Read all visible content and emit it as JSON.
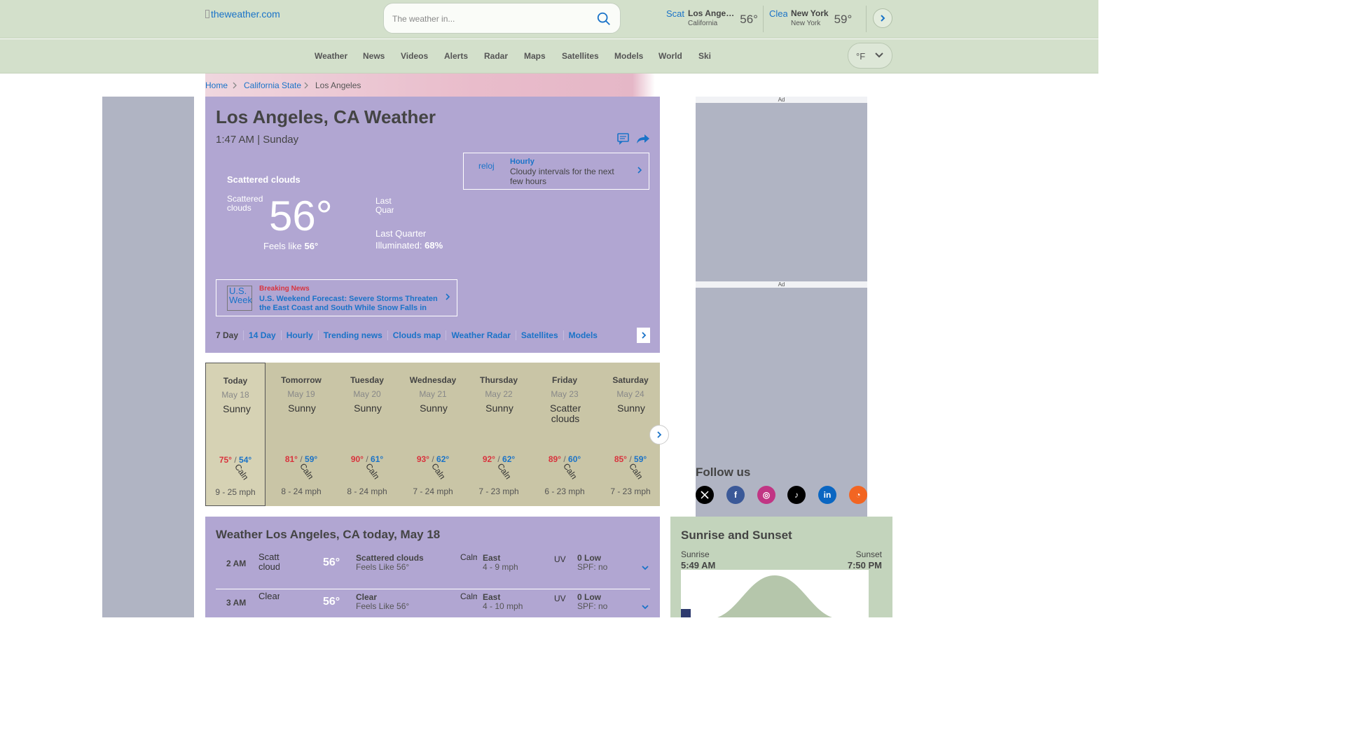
{
  "header": {
    "logo_alt": "theweather.com",
    "search_placeholder": "The weather in...",
    "locations": [
      {
        "icon_alt": "Scat",
        "name": "Los Ange…",
        "state": "California",
        "temp": "56°"
      },
      {
        "icon_alt": "Clea",
        "name": "New York",
        "state": "New York",
        "temp": "59°"
      }
    ]
  },
  "nav": {
    "items": [
      "Weather",
      "News",
      "Videos",
      "Alerts",
      "Radar",
      "Maps",
      "Satellites",
      "Models",
      "World",
      "Ski"
    ],
    "unit": "°F"
  },
  "breadcrumb": [
    "Home",
    "California State",
    "Los Angeles"
  ],
  "current": {
    "title": "Los Angeles, CA Weather",
    "time": "1:47 AM | Sunday",
    "condition": "Scattered clouds",
    "condition_img_alt": "Scattered clouds",
    "temp": "56°",
    "feels_label": "Feels like",
    "feels_value": "56°",
    "moon_img_alt": "Last Quar",
    "moon_phase": "Last Quarter",
    "illuminated_label": "Illuminated:",
    "illuminated_value": "68%",
    "hourly_card": {
      "icon_alt": "reloj",
      "title": "Hourly",
      "text": "Cloudy intervals for the next few hours"
    },
    "news_card": {
      "icon_alt": "U.S. Week",
      "label": "Breaking News",
      "text": "U.S. Weekend Forecast: Severe Storms Threaten the East Coast and South While Snow Falls in th…"
    },
    "subnav": [
      "7 Day",
      "14 Day",
      "Hourly",
      "Trending news",
      "Clouds map",
      "Weather Radar",
      "Satellites",
      "Models"
    ]
  },
  "forecast": {
    "days": [
      {
        "name": "Today",
        "date": "May 18",
        "icon_alt": "Sunny",
        "hi": "75°",
        "lo": "54°",
        "wind_alt": "Calm",
        "wind": "9 - 25 mph"
      },
      {
        "name": "Tomorrow",
        "date": "May 19",
        "icon_alt": "Sunny",
        "hi": "81°",
        "lo": "59°",
        "wind_alt": "Calm",
        "wind": "8 - 24 mph"
      },
      {
        "name": "Tuesday",
        "date": "May 20",
        "icon_alt": "Sunny",
        "hi": "90°",
        "lo": "61°",
        "wind_alt": "Calm",
        "wind": "8 - 24 mph"
      },
      {
        "name": "Wednesday",
        "date": "May 21",
        "icon_alt": "Sunny",
        "hi": "93°",
        "lo": "62°",
        "wind_alt": "Calm",
        "wind": "7 - 24 mph"
      },
      {
        "name": "Thursday",
        "date": "May 22",
        "icon_alt": "Sunny",
        "hi": "92°",
        "lo": "62°",
        "wind_alt": "Calm",
        "wind": "7 - 23 mph"
      },
      {
        "name": "Friday",
        "date": "May 23",
        "icon_alt": "Scattered clouds",
        "hi": "89°",
        "lo": "60°",
        "wind_alt": "Calm",
        "wind": "6 - 23 mph"
      },
      {
        "name": "Saturday",
        "date": "May 24",
        "icon_alt": "Sunny",
        "hi": "85°",
        "lo": "59°",
        "wind_alt": "Calm",
        "wind": "7 - 23 mph"
      }
    ],
    "separator": "/"
  },
  "today": {
    "title": "Weather Los Angeles, CA today, May 18",
    "rows": [
      {
        "hour": "2 AM",
        "icon_alt": "Scattered clouds",
        "temp": "56°",
        "condition": "Scattered clouds",
        "feels": "Feels Like 56°",
        "wind_alt": "Calm",
        "wind_dir": "East",
        "wind_speed": "4 - 9 mph",
        "uv_alt": "UV",
        "uv": "0 Low",
        "spf": "SPF: no"
      },
      {
        "hour": "3 AM",
        "icon_alt": "Clear",
        "temp": "56°",
        "condition": "Clear",
        "feels": "Feels Like 56°",
        "wind_alt": "Calm",
        "wind_dir": "East",
        "wind_speed": "4 - 10 mph",
        "uv_alt": "UV",
        "uv": "0 Low",
        "spf": "SPF: no"
      }
    ]
  },
  "sidebar": {
    "ad_label": "Ad",
    "follow_title": "Follow us",
    "social": [
      {
        "name": "x",
        "glyph": "𝕏",
        "color": "#000000"
      },
      {
        "name": "facebook",
        "glyph": "f",
        "color": "#3b5998"
      },
      {
        "name": "instagram",
        "glyph": "◎",
        "color": "#c13584"
      },
      {
        "name": "tiktok",
        "glyph": "♪",
        "color": "#000000"
      },
      {
        "name": "linkedin",
        "glyph": "in",
        "color": "#0a66c2"
      },
      {
        "name": "rss",
        "glyph": "◔",
        "color": "#f26522"
      }
    ],
    "sun": {
      "title": "Sunrise and Sunset",
      "sunrise_label": "Sunrise",
      "sunrise": "5:49 AM",
      "sunset_label": "Sunset",
      "sunset": "7:50 PM"
    }
  },
  "colors": {
    "accent": "#1a73c8",
    "hi_temp": "#d9333d",
    "lo_temp": "#1a73c8",
    "header_bg": "#d3e0cb"
  }
}
